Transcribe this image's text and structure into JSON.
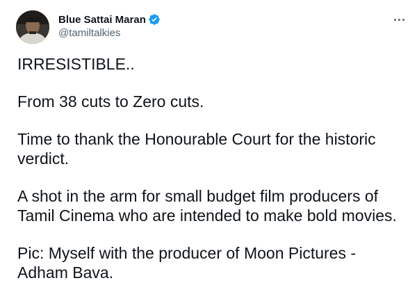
{
  "tweet": {
    "author": {
      "display_name": "Blue Sattai Maran",
      "handle": "@tamiltalkies",
      "verified": true,
      "verified_color": "#1d9bf0"
    },
    "more_menu_icon": "more-horizontal-icon",
    "paragraphs": [
      "IRRESISTIBLE..",
      "From 38 cuts to Zero cuts.",
      "Time to thank the Honourable Court for the historic verdict.",
      "A shot in the arm for small budget film producers of Tamil Cinema who are intended to make bold movies.",
      "Pic: Myself with the producer of Moon Pictures - Adham Bava."
    ]
  }
}
